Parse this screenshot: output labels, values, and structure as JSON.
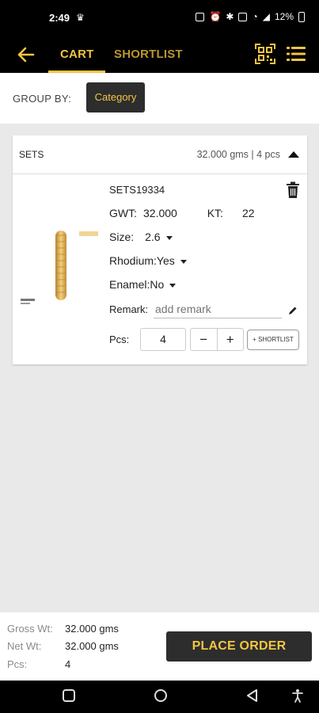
{
  "status_bar": {
    "time": "2:49",
    "battery": "12%"
  },
  "header": {
    "tabs": [
      {
        "label": "CART",
        "active": true
      },
      {
        "label": "SHORTLIST",
        "active": false
      }
    ],
    "accent_color": "#f4c542"
  },
  "group_by": {
    "label": "GROUP BY:",
    "value": "Category"
  },
  "card": {
    "group_name": "SETS",
    "summary": "32.000 gms | 4 pcs",
    "item": {
      "sku": "SETS19334",
      "gwt_label": "GWT:",
      "gwt_value": "32.000",
      "kt_label": "KT:",
      "kt_value": "22",
      "size_label": "Size:",
      "size_value": "2.6",
      "rhodium_label": "Rhodium:",
      "rhodium_value": "Yes",
      "enamel_label": "Enamel:",
      "enamel_value": "No",
      "remark_label": "Remark:",
      "remark_placeholder": "add remark",
      "pcs_label": "Pcs:",
      "pcs_value": "4",
      "shortlist_label": "+ SHORTLIST"
    }
  },
  "footer": {
    "gross_label": "Gross Wt:",
    "gross_value": "32.000 gms",
    "net_label": "Net Wt:",
    "net_value": "32.000 gms",
    "pcs_label": "Pcs:",
    "pcs_value": "4",
    "place_order_label": "PLACE ORDER"
  }
}
